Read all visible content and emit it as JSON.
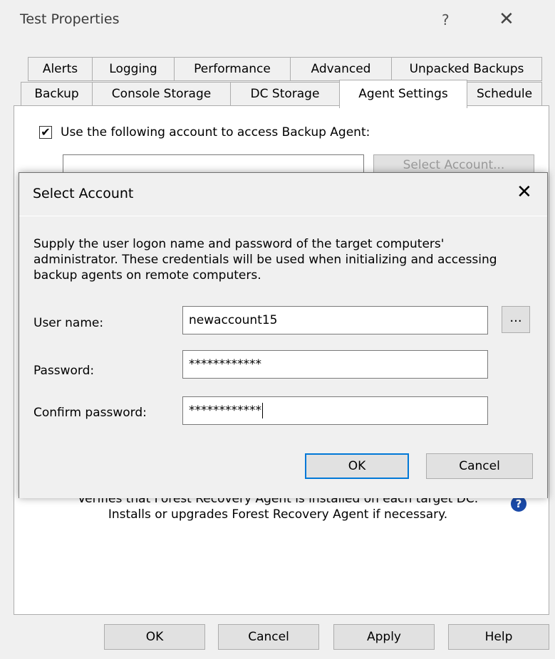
{
  "window": {
    "title": "Test Properties",
    "help_label": "?",
    "close_label": "✕"
  },
  "tabs_row1": [
    "Alerts",
    "Logging",
    "Performance",
    "Advanced",
    "Unpacked Backups"
  ],
  "tabs_row2": [
    "Backup",
    "Console Storage",
    "DC Storage",
    "Agent Settings",
    "Schedule"
  ],
  "active_tab": "Agent Settings",
  "agent_settings": {
    "use_account_checkbox_label": "Use the following account to access Backup Agent:",
    "use_account_checked": true,
    "checkmark": "✔",
    "account_value": "",
    "select_account_button": "Select Account...",
    "info_text": "Verifies that Forest Recovery Agent is installed on each target DC. Installs or upgrades Forest Recovery Agent if necessary.",
    "help_icon_glyph": "?"
  },
  "bottom_buttons": {
    "ok": "OK",
    "cancel": "Cancel",
    "apply": "Apply",
    "help": "Help"
  },
  "dialog": {
    "title": "Select Account",
    "close_label": "✕",
    "description": "Supply the user logon name and password of the target computers' administrator. These credentials will be used when initializing and accessing backup agents on remote computers.",
    "username_label": "User name:",
    "username_value": "newaccount15",
    "browse_button": "...",
    "password_label": "Password:",
    "password_value": "************",
    "confirm_label": "Confirm password:",
    "confirm_value": "************",
    "ok": "OK",
    "cancel": "Cancel"
  }
}
